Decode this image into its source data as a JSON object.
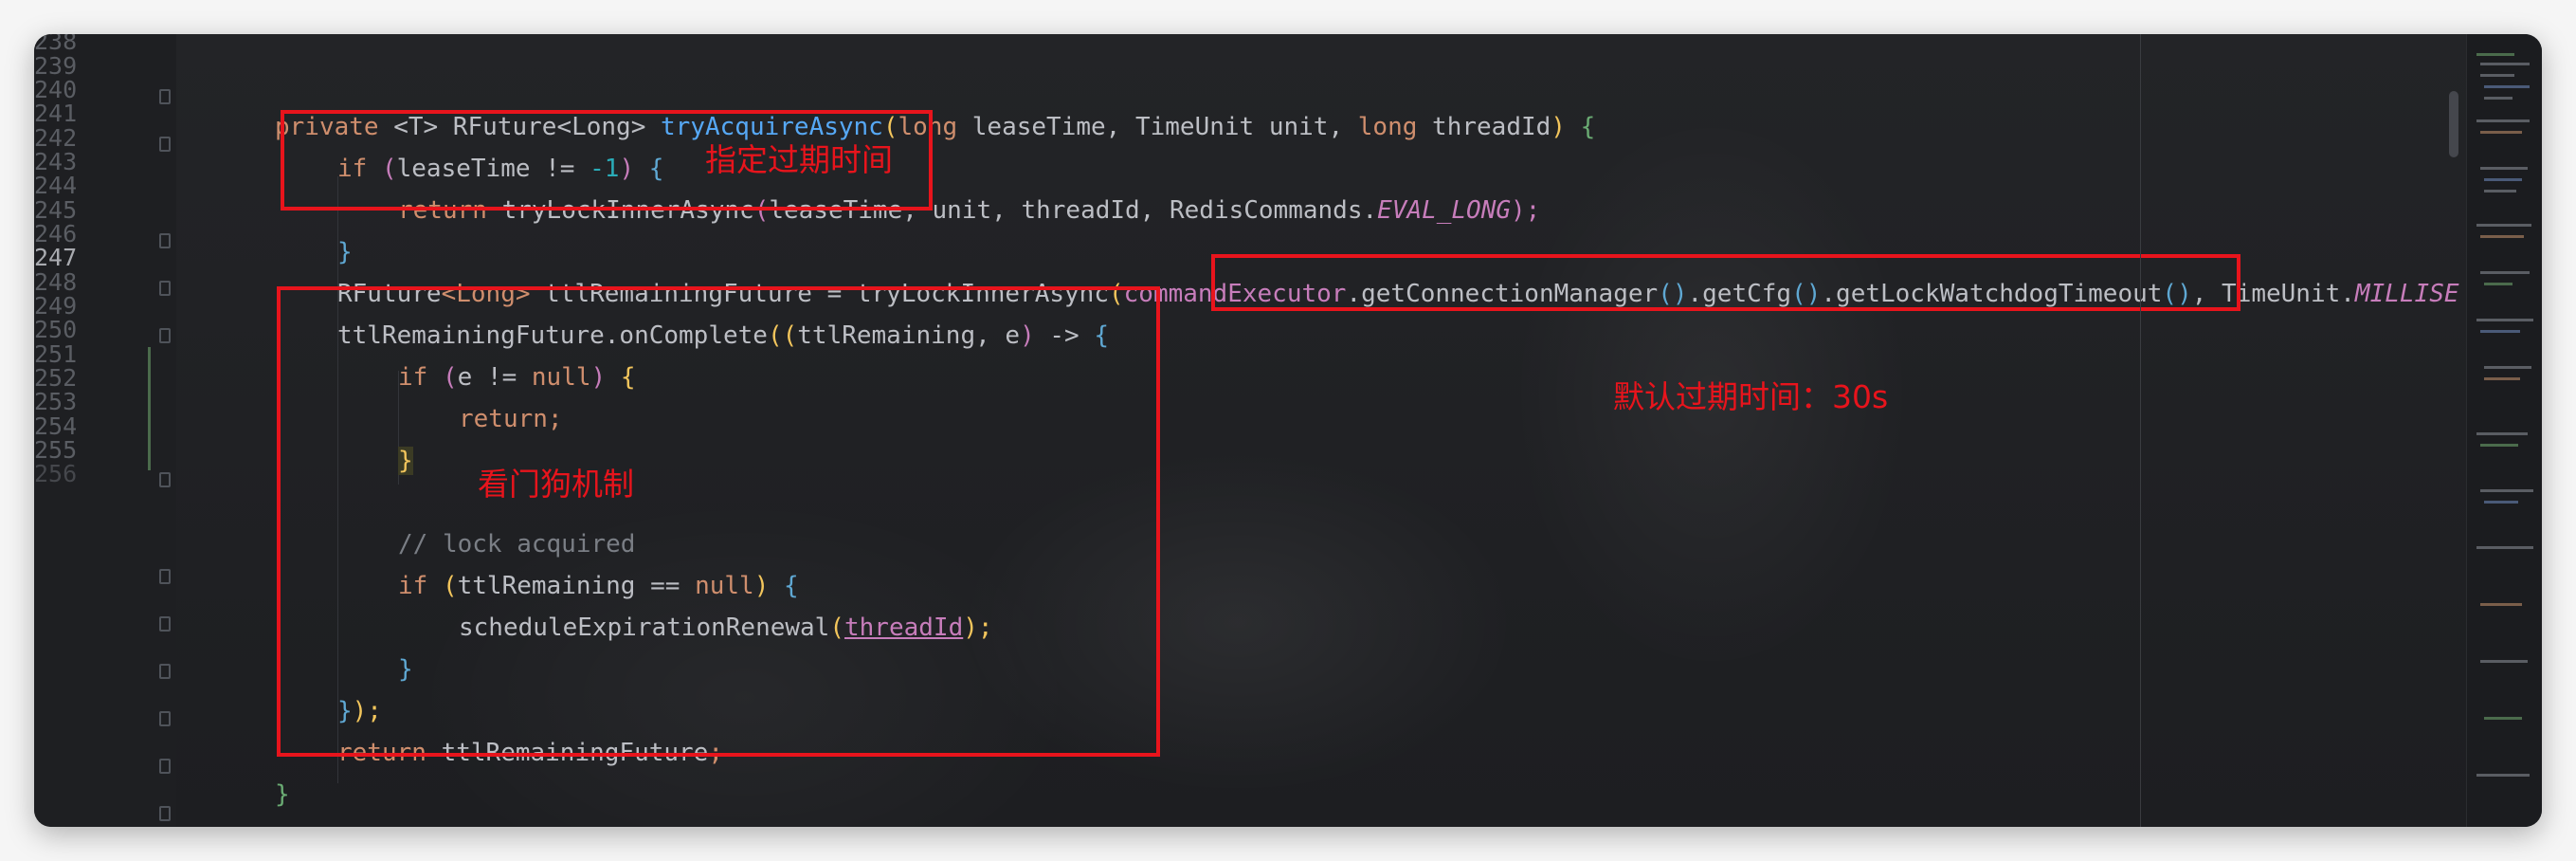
{
  "editor": {
    "line_numbers": [
      "238",
      "239",
      "240",
      "241",
      "242",
      "243",
      "244",
      "245",
      "246",
      "247",
      "248",
      "249",
      "250",
      "251",
      "252",
      "253",
      "254",
      "255",
      "256"
    ],
    "code": {
      "l239": {
        "kw_private": "private ",
        "generic": "<T> ",
        "ret_type": "RFuture",
        "gen_open": "<",
        "gen_type": "Long",
        "gen_close": "> ",
        "method": "tryAcquireAsync",
        "paren_open": "(",
        "kw_long1": "long",
        "param1": " leaseTime, ",
        "param2": "TimeUnit unit, ",
        "kw_long2": "long",
        "param3": " threadId",
        "paren_close": ")",
        "brace": " {"
      },
      "l240": {
        "kw_if": "if ",
        "open": "(",
        "expr": "leaseTime != ",
        "num": "-1",
        "close": ")",
        "brace": " {"
      },
      "l241": {
        "kw_return": "return ",
        "call": "tryLockInnerAsync",
        "open": "(",
        "args": "leaseTime, unit, threadId, RedisCommands.",
        "const": "EVAL_LONG",
        "close": ");"
      },
      "l242": {
        "brace": "}"
      },
      "l243": {
        "type": "RFuture",
        "gen": "<Long>",
        "decl": " ttlRemainingFuture = tryLockInnerAsync",
        "open": "(",
        "field": "commandExecutor",
        "chain1": ".getConnectionManager",
        "p1": "()",
        "chain2": ".getCfg",
        "p2": "()",
        "chain3": ".getLockWatchdogTimeout",
        "p3": "()",
        "tail": ", TimeUnit.",
        "const": "MILLISE"
      },
      "l244": {
        "obj": "ttlRemainingFuture.onComplete",
        "open": "((",
        "params": "ttlRemaining, e",
        "close": ")",
        "arrow": " -> ",
        "brace": "{"
      },
      "l245": {
        "kw_if": "if ",
        "open": "(",
        "expr": "e != ",
        "kw_null": "null",
        "close": ")",
        "brace": " {"
      },
      "l246": {
        "kw_return": "return",
        "semi": ";"
      },
      "l247": {
        "brace": "}"
      },
      "l248": {
        "text": ""
      },
      "l249": {
        "comment": "// lock acquired"
      },
      "l250": {
        "kw_if": "if ",
        "open": "(",
        "expr": "ttlRemaining == ",
        "kw_null": "null",
        "close": ")",
        "brace": " {"
      },
      "l251": {
        "call": "scheduleExpirationRenewal",
        "open": "(",
        "arg": "threadId",
        "close": ");"
      },
      "l252": {
        "brace": "}"
      },
      "l253": {
        "brace": "}",
        "rest": ");"
      },
      "l254": {
        "kw_return": "return ",
        "value": "ttlRemainingFuture",
        "semi": ";"
      },
      "l255": {
        "brace": "}"
      }
    }
  },
  "annotations": {
    "expire_label": "指定过期时间",
    "default_expire_label": "默认过期时间：30s",
    "watchdog_label": "看门狗机制",
    "color": "#e8141c"
  },
  "theme": {
    "background": "#1f2023",
    "keyword": "#cf8e6d",
    "method": "#56a8f5",
    "constant": "#c77dbb",
    "number": "#2aacb8",
    "comment": "#7a7e85"
  }
}
